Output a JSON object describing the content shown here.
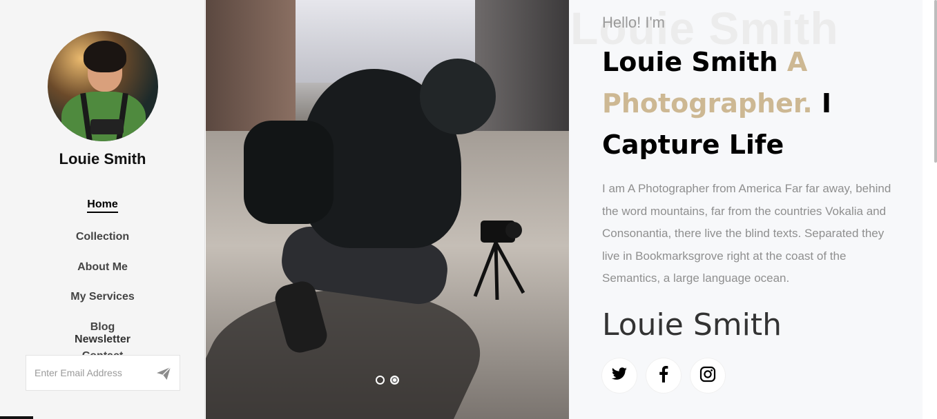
{
  "sidebar": {
    "name": "Louie Smith",
    "nav": [
      {
        "label": "Home",
        "active": true
      },
      {
        "label": "Collection",
        "active": false
      },
      {
        "label": "About Me",
        "active": false
      },
      {
        "label": "My Services",
        "active": false
      },
      {
        "label": "Blog",
        "active": false
      }
    ],
    "nav_partial": "Contact",
    "newsletter_title": "Newsletter",
    "email_placeholder": "Enter Email Address",
    "send_icon": "paper-plane-icon"
  },
  "slider": {
    "dots": 2,
    "active_index": 1
  },
  "intro": {
    "watermark": "Louie Smith",
    "greeting": "Hello! I'm",
    "headline_name": "Louie Smith",
    "headline_accent": "A Photographer.",
    "headline_tail": "I Capture Life",
    "description": "I am A Photographer from America Far far away, behind the word mountains, far from the countries Vokalia and Consonantia, there live the blind texts. Separated they live in Bookmarksgrove right at the coast of the Semantics, a large language ocean.",
    "signature": "Louie Smith",
    "socials": [
      {
        "icon": "twitter-icon"
      },
      {
        "icon": "facebook-icon"
      },
      {
        "icon": "instagram-icon"
      }
    ]
  },
  "colors": {
    "accent": "#cdb893",
    "sidebar_bg": "#f5f5f5",
    "text_muted": "#8f8f8f"
  }
}
